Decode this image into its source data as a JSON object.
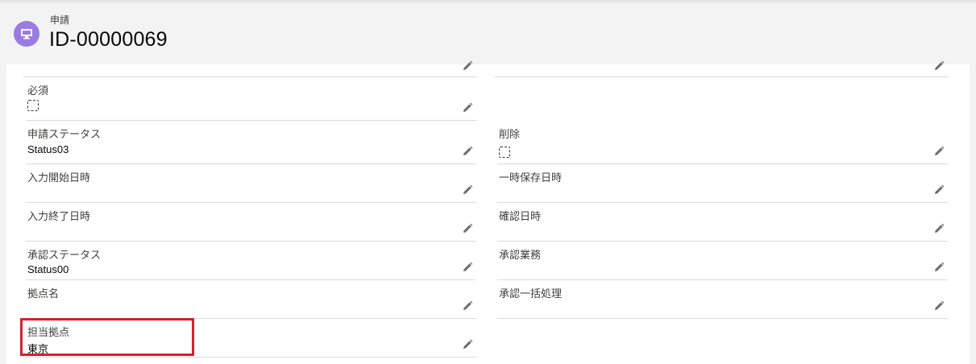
{
  "header": {
    "object_label": "申請",
    "record_title": "ID-00000069",
    "icon": "desktop-icon",
    "icon_color": "#9a7be0"
  },
  "fields": {
    "required": {
      "label": "必須",
      "value": "",
      "type": "checkbox",
      "checked": false
    },
    "request_status": {
      "label": "申請ステータス",
      "value": "Status03"
    },
    "delete": {
      "label": "削除",
      "value": "",
      "type": "checkbox",
      "checked": false
    },
    "input_start": {
      "label": "入力開始日時",
      "value": ""
    },
    "temp_save": {
      "label": "一時保存日時",
      "value": ""
    },
    "input_end": {
      "label": "入力終了日時",
      "value": ""
    },
    "confirm_date": {
      "label": "確認日時",
      "value": ""
    },
    "approval_status": {
      "label": "承認ステータス",
      "value": "Status00"
    },
    "approval_work": {
      "label": "承認業務",
      "value": ""
    },
    "base_name": {
      "label": "拠点名",
      "value": ""
    },
    "bulk_approval": {
      "label": "承認一括処理",
      "value": ""
    },
    "assigned_base": {
      "label": "担当拠点",
      "value": "東京"
    }
  },
  "colors": {
    "highlight_border": "#d8202a",
    "divider": "#dddbda",
    "background": "#f3f3f3"
  }
}
